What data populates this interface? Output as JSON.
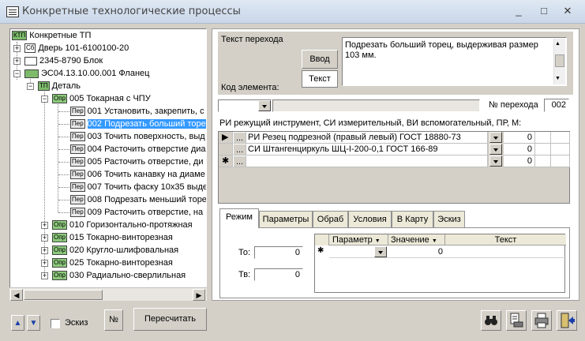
{
  "window": {
    "title": "Конкретные технологические процессы",
    "minimize": "_",
    "maximize": "□",
    "close": "✕"
  },
  "tree": {
    "root": {
      "badge": "КТП",
      "label": "Конкретные ТП"
    },
    "items": [
      {
        "badge": "Сб",
        "label": "Дверь 101-6100100-20"
      },
      {
        "badge": "",
        "label": "2345-8790 Блок"
      },
      {
        "badge": "",
        "label": "ЭС04.13.10.00.001 Фланец"
      },
      {
        "badge": "ТП",
        "label": "Деталь"
      },
      {
        "badge": "Опр",
        "label": "005 Токарная с ЧПУ"
      },
      {
        "badge": "Пер",
        "label": "001 Установить, закрепить, с"
      },
      {
        "badge": "Пер",
        "label": "002 Подрезать больший торе"
      },
      {
        "badge": "Пер",
        "label": "003 Точить поверхность, выд"
      },
      {
        "badge": "Пер",
        "label": "004 Расточить отверстие диа"
      },
      {
        "badge": "Пер",
        "label": "005 Расточить отверстие, ди"
      },
      {
        "badge": "Пер",
        "label": "006 Точить канавку на диаме"
      },
      {
        "badge": "Пер",
        "label": "007 Точить фаску 10х35 выде"
      },
      {
        "badge": "Пер",
        "label": "008 Подрезать меньший торе"
      },
      {
        "badge": "Пер",
        "label": "009 Расточить отверстие, на"
      },
      {
        "badge": "Опр",
        "label": "010 Горизонтально-протяжная"
      },
      {
        "badge": "Опр",
        "label": "015 Токарно-винторезная"
      },
      {
        "badge": "Опр",
        "label": "020 Кругло-шлифовальная"
      },
      {
        "badge": "Опр",
        "label": "025 Токарно-винторезная"
      },
      {
        "badge": "Опр",
        "label": "030 Радиально-сверлильная"
      }
    ],
    "scroll_left": "◀",
    "scroll_right": "▶"
  },
  "bottom_left": {
    "up_arrow": "▲",
    "down_arrow": "▼",
    "sketch_label": "Эскиз",
    "number_button": "№",
    "recalc_button": "Пересчитать"
  },
  "transition": {
    "label": "Текст перехода",
    "input_button": "Ввод",
    "text_button": "Текст",
    "text": "Подрезать больший торец, выдерживая размер 103 мм.",
    "element_code_label": "Код элемента:",
    "transition_number_label": "№ перехода",
    "transition_number": "002"
  },
  "tools": {
    "header": "РИ режущий инструмент, СИ измерительный, ВИ вспомогательный, ПР, М:",
    "rows": [
      {
        "marker": "▶",
        "name": "РИ Резец подрезной (правый левый) ГОСТ 18880-73",
        "qty": "0"
      },
      {
        "marker": "",
        "name": "СИ Штангенциркуль ШЦ-I-200-0,1 ГОСТ 166-89",
        "qty": "0"
      },
      {
        "marker": "✱",
        "name": "",
        "qty": "0"
      }
    ],
    "dots": "..."
  },
  "tabs": [
    "Режим",
    "Параметры",
    "Обраб",
    "Условия",
    "В Карту",
    "Эскиз"
  ],
  "mode": {
    "to_label": "То:",
    "to_value": "0",
    "tv_label": "Тв:",
    "tv_value": "0",
    "grid_headers": [
      "Параметр",
      "Значение",
      "Текст"
    ],
    "grid_new_marker": "✱",
    "grid_value": "0"
  },
  "colors": {
    "selection": "#3399ff",
    "window_bg": "#d4d0c8",
    "badge_green": "#7dbb6b"
  }
}
